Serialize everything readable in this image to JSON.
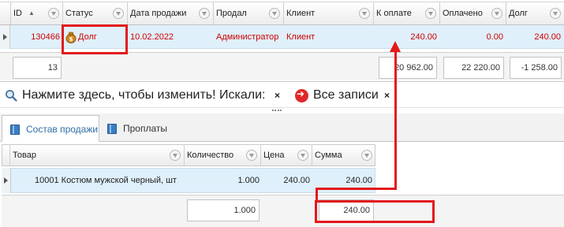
{
  "top_grid": {
    "columns": [
      {
        "label": "ID",
        "sort": "▲"
      },
      {
        "label": "Статус"
      },
      {
        "label": "Дата продажи"
      },
      {
        "label": "Продал"
      },
      {
        "label": "Клиент"
      },
      {
        "label": "К оплате"
      },
      {
        "label": "Оплачено"
      },
      {
        "label": "Долг"
      }
    ],
    "row": {
      "id": "130466",
      "status": "Долг",
      "date": "10.02.2022",
      "seller": "Администратор",
      "client": "Клиент",
      "to_pay": "240.00",
      "paid": "0.00",
      "debt": "240.00"
    },
    "totals": {
      "count": "13",
      "to_pay": "20 962.00",
      "paid": "22 220.00",
      "debt": "-1 258.00"
    }
  },
  "filter_bar": {
    "prompt": "Нажмите здесь, чтобы изменить! Искали:",
    "all_records": "Все записи",
    "close_glyph": "×"
  },
  "tabs": [
    {
      "label": "Состав продажи",
      "active": true
    },
    {
      "label": "Проплаты",
      "active": false
    }
  ],
  "bottom_grid": {
    "columns": [
      "Товар",
      "Количество",
      "Цена",
      "Сумма"
    ],
    "row": {
      "code": "10001",
      "name": "Костюм мужской черный, шт",
      "qty": "1.000",
      "price": "240.00",
      "sum": "240.00"
    },
    "totals": {
      "qty": "1.000",
      "sum": "240.00"
    }
  },
  "colors": {
    "accent_red": "#e3191c",
    "row_selected": "#dff0fb",
    "debt_text": "#d40000"
  }
}
